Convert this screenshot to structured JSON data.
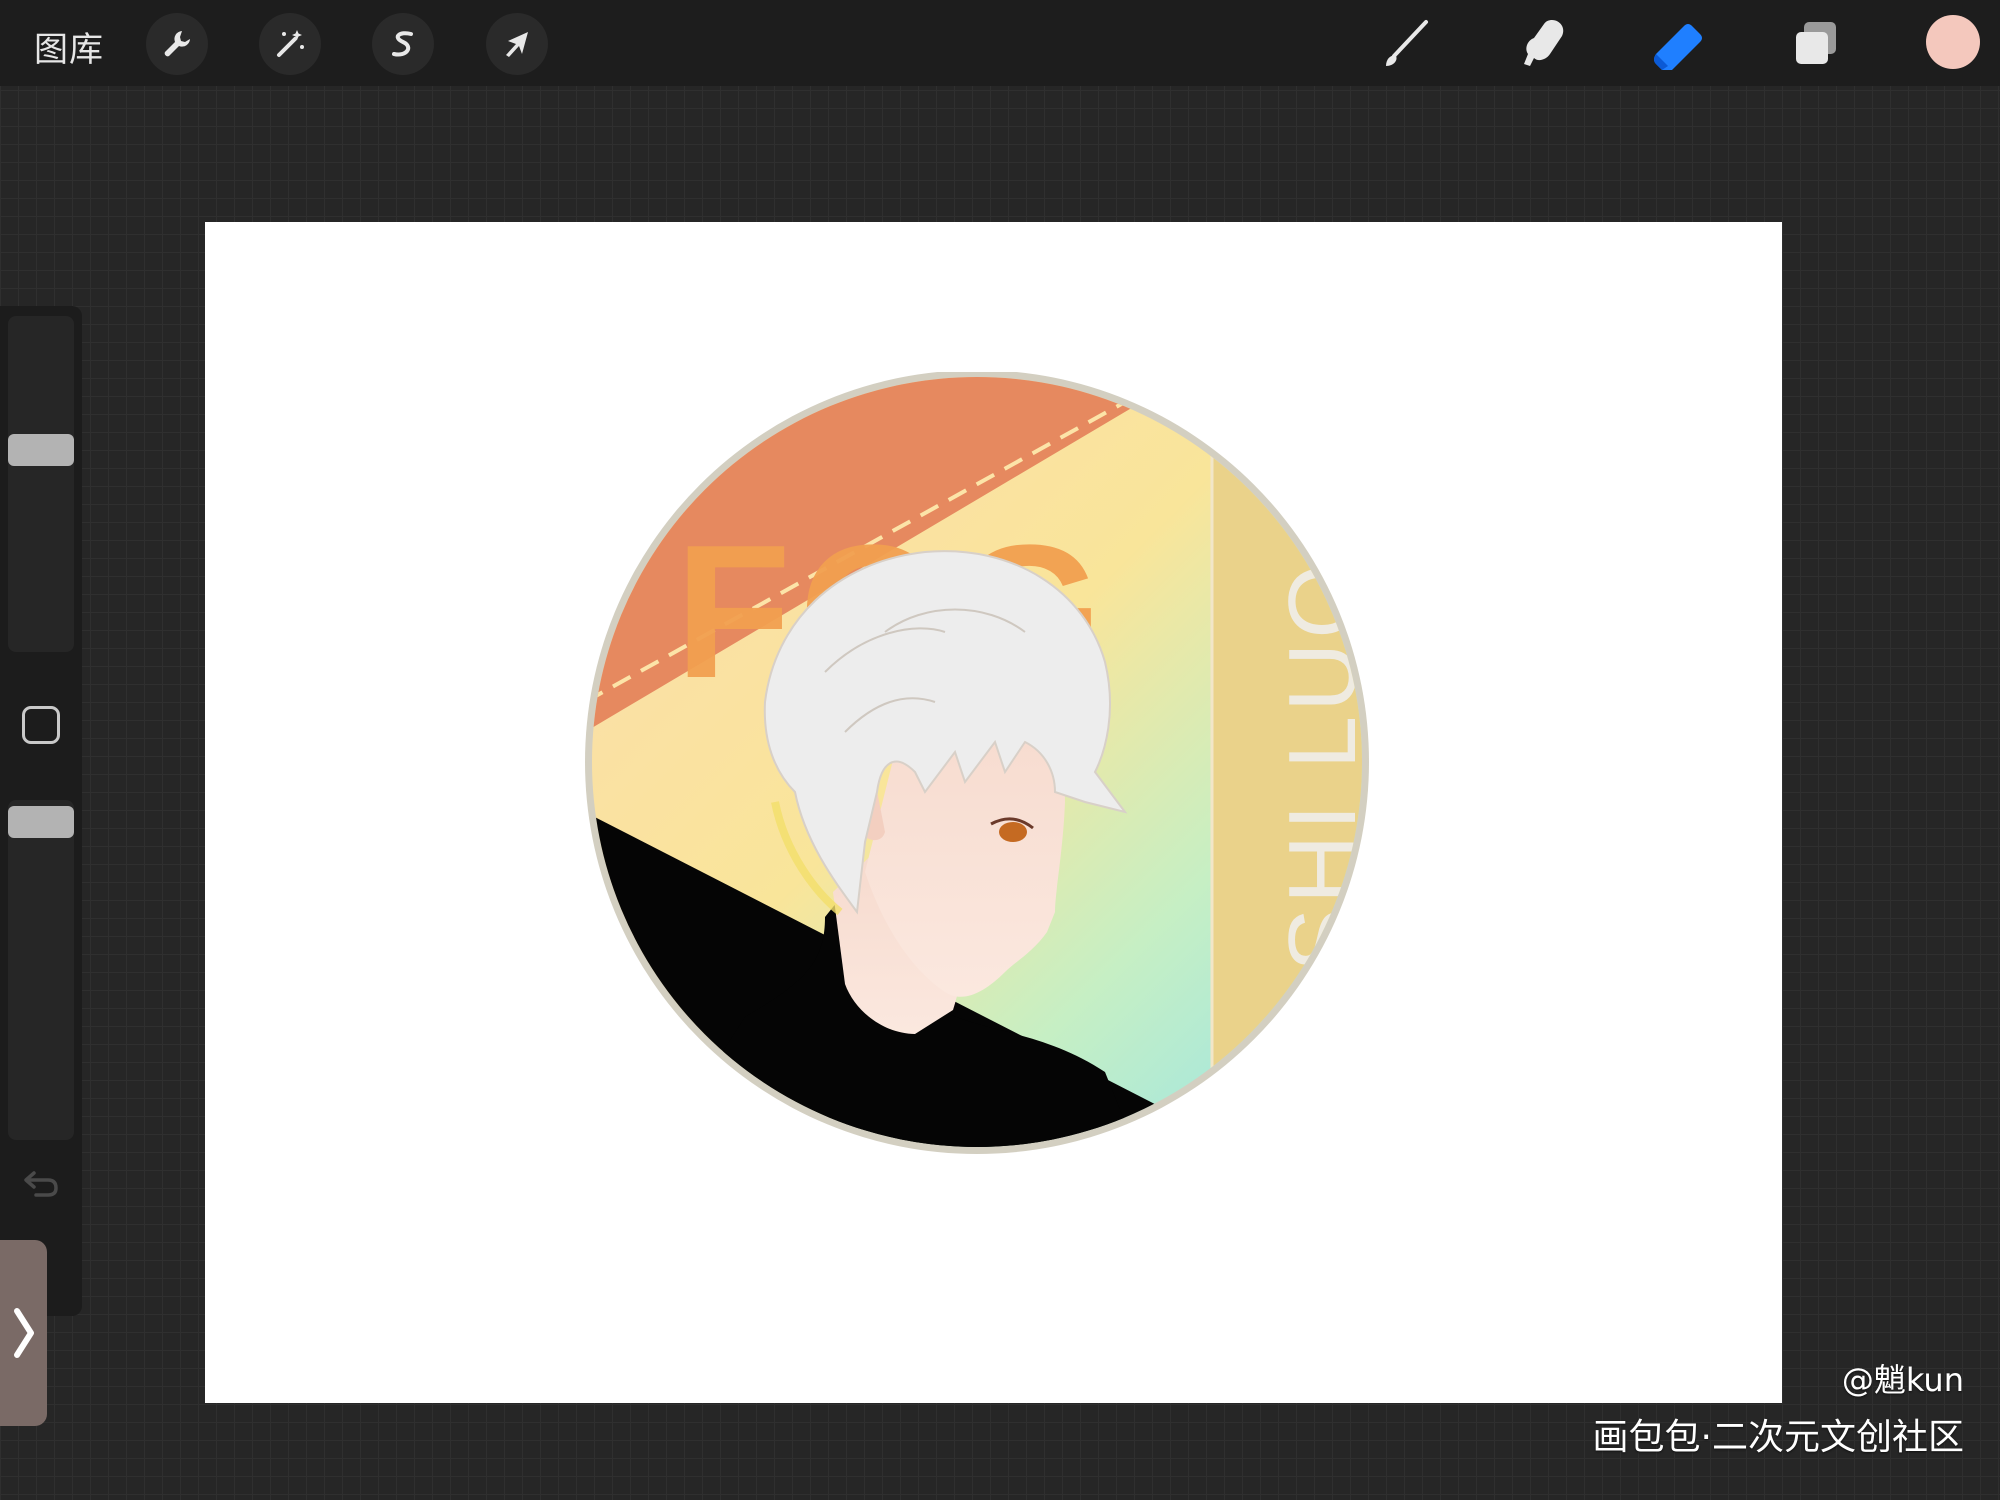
{
  "topbar": {
    "gallery_label": "图库",
    "left_tools": [
      {
        "name": "actions",
        "icon": "wrench-icon"
      },
      {
        "name": "adjustments",
        "icon": "magic-wand-icon"
      },
      {
        "name": "selection",
        "icon": "selection-s-icon"
      },
      {
        "name": "transform",
        "icon": "arrow-cursor-icon"
      }
    ],
    "right_tools": [
      {
        "name": "brush",
        "icon": "brush-icon",
        "active": false
      },
      {
        "name": "smudge",
        "icon": "smudge-finger-icon",
        "active": false
      },
      {
        "name": "eraser",
        "icon": "eraser-icon",
        "active": true
      },
      {
        "name": "layers",
        "icon": "layers-icon",
        "active": false
      }
    ],
    "current_color": "#f4c8bd"
  },
  "sidebar": {
    "brush_size_level": 0.58,
    "opacity_level": 0.36,
    "modify_icon": "square-icon",
    "undo_icon": "undo-icon",
    "expand_icon": "chevron-right-icon"
  },
  "artwork": {
    "title_text": "FOG",
    "vertical_text": "SHI LUO",
    "colors": {
      "orange": "#e6895f",
      "title_orange": "#f2a050",
      "yellow_band": "#ead28a",
      "ring": "#d3cfc1",
      "hair": "#ededed"
    }
  },
  "watermark": {
    "author": "@魈kun",
    "site": "画包包·二次元文创社区"
  },
  "accent_color": "#1f7fff"
}
